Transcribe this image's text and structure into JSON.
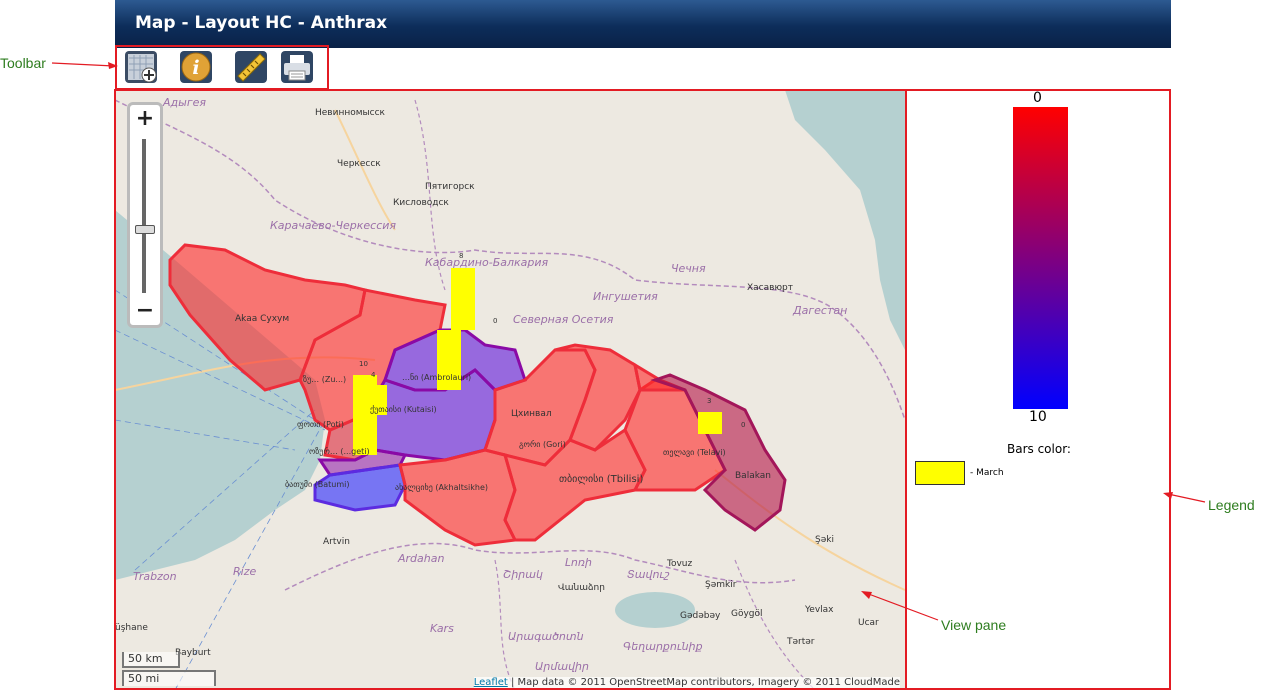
{
  "window": {
    "title": "Map - Layout HC - Anthrax"
  },
  "toolbar": {
    "tools": [
      {
        "icon": "add-layer-icon"
      },
      {
        "icon": "info-icon"
      },
      {
        "icon": "measure-ruler-icon"
      },
      {
        "icon": "print-icon"
      }
    ]
  },
  "annotations": {
    "toolbar": "Toolbar",
    "legend": "Legend",
    "view_pane": "View pane"
  },
  "map": {
    "zoom_in": "+",
    "zoom_out": "−",
    "scale_km": "50 km",
    "scale_mi": "50 mi",
    "attribution_link": "Leaflet",
    "attribution_text": " | Map data © 2011 OpenStreetMap contributors, Imagery © 2011 CloudMade",
    "place_labels": [
      "Адыгея",
      "Невинномысск",
      "Черкесск",
      "Пятигорск",
      "Кисловодск",
      "Карачаево-Черкессия",
      "Кабардино-Балкария",
      "Чечня",
      "Хасавюрт",
      "Ингушетия",
      "Северная Осетия",
      "Дагестан",
      "Akaa Сухум",
      "Цхинвал",
      "თბილისი (Tbilisi)",
      "Balakan",
      "Şəki",
      "Artvin",
      "Ardahan",
      "Trabzon",
      "Rize",
      "Kars",
      "Tovuz",
      "Şəmkir",
      "Gədəbəy",
      "Göygöl",
      "Yevlax",
      "Ucar",
      "Tərtər",
      "Bayburt",
      "üşhane",
      "Արմավիր",
      "Վանաձոր",
      "Լոռի",
      "Շիրակ",
      "Տավուշ",
      "Արագածոտն",
      "Գեղարքունիք"
    ],
    "region_labels": [
      "(Zu...)",
      "(Ambrolauri)",
      "(Kutaisi)",
      "(Poti)",
      "(...geti)",
      "(Batumi)",
      "(Akhaltsikhe)",
      "(Gori)",
      "(Telavi)"
    ],
    "bar_values": [
      "8",
      "0",
      "10",
      "4",
      "3",
      "0"
    ]
  },
  "legend": {
    "scale_top": "0",
    "scale_bottom": "10",
    "color_top": "#ff0000",
    "color_bottom": "#0000ff",
    "bars_title": "Bars color:",
    "bar_entries": [
      {
        "label": "- March",
        "color": "#ffff00"
      }
    ]
  },
  "colors": {
    "title_bg": "#0d2d5a",
    "annotation_red": "#e31b23",
    "annotation_green": "#2e7d1f"
  }
}
